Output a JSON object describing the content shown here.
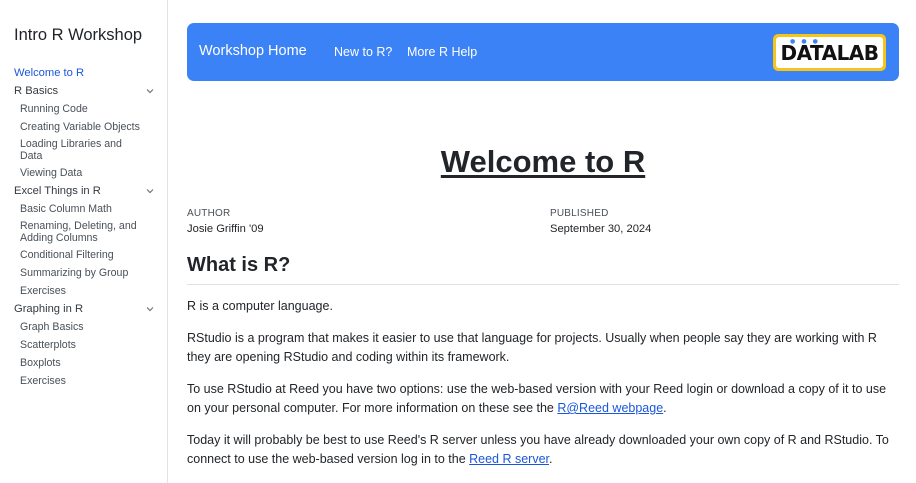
{
  "sidebar": {
    "title": "Intro R Workshop",
    "items": [
      {
        "type": "top",
        "label": "Welcome to R",
        "active": true
      },
      {
        "type": "section",
        "label": "R Basics"
      },
      {
        "type": "sub",
        "label": "Running Code"
      },
      {
        "type": "sub",
        "label": "Creating Variable Objects"
      },
      {
        "type": "sub",
        "label": "Loading Libraries and Data",
        "wrap": true
      },
      {
        "type": "sub",
        "label": "Viewing Data"
      },
      {
        "type": "section",
        "label": "Excel Things in R"
      },
      {
        "type": "sub",
        "label": "Basic Column Math"
      },
      {
        "type": "sub",
        "label": "Renaming, Deleting, and Adding Columns",
        "wrap": true
      },
      {
        "type": "sub",
        "label": "Conditional Filtering"
      },
      {
        "type": "sub",
        "label": "Summarizing by Group"
      },
      {
        "type": "sub",
        "label": "Exercises"
      },
      {
        "type": "section",
        "label": "Graphing in R"
      },
      {
        "type": "sub",
        "label": "Graph Basics"
      },
      {
        "type": "sub",
        "label": "Scatterplots"
      },
      {
        "type": "sub",
        "label": "Boxplots"
      },
      {
        "type": "sub",
        "label": "Exercises"
      }
    ]
  },
  "navbar": {
    "brand": "Workshop Home",
    "links": [
      "New to R?",
      "More R Help"
    ],
    "logo_text": "DATALAB",
    "accent_color": "#3b82f6"
  },
  "main": {
    "title": "Welcome to R",
    "author_label": "AUTHOR",
    "author": "Josie Griffin '09",
    "published_label": "PUBLISHED",
    "published": "September 30, 2024",
    "section_heading": "What is R?",
    "para1": "R is a computer language.",
    "para2": "RStudio is a program that makes it easier to use that language for projects. Usually when people say they are working with R they are opening RStudio and coding within its framework.",
    "para3_text": "To use RStudio at Reed you have two options: use the web-based version with your Reed login or download a copy of it to use on your personal computer. For more information on these see the ",
    "para3_link": "R@Reed webpage",
    "para3_end": ".",
    "para4_text": "Today it will probably be best to use Reed's R server unless you have already downloaded your own copy of R and RStudio. To connect to use the web-based version log in to the ",
    "para4_link": "Reed R server",
    "para4_end": "."
  }
}
